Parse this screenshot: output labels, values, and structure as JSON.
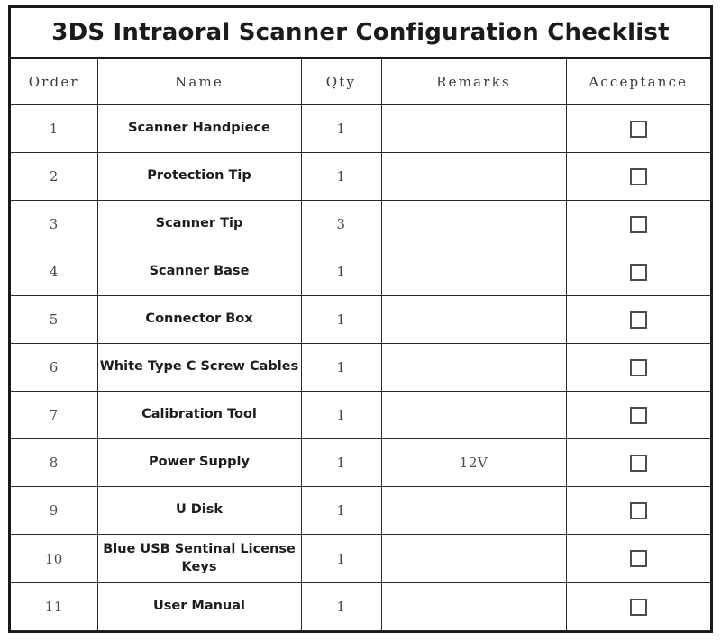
{
  "document": {
    "title": "3DS Intraoral Scanner Configuration Checklist"
  },
  "table": {
    "columns": [
      {
        "key": "order",
        "label": "Order"
      },
      {
        "key": "name",
        "label": "Name"
      },
      {
        "key": "qty",
        "label": "Qty"
      },
      {
        "key": "remarks",
        "label": "Remarks"
      },
      {
        "key": "acceptance",
        "label": "Acceptance"
      }
    ],
    "rows": [
      {
        "order": "1",
        "name": "Scanner Handpiece",
        "qty": "1",
        "remarks": "",
        "acceptance_checked": false
      },
      {
        "order": "2",
        "name": "Protection Tip",
        "qty": "1",
        "remarks": "",
        "acceptance_checked": false
      },
      {
        "order": "3",
        "name": "Scanner Tip",
        "qty": "3",
        "remarks": "",
        "acceptance_checked": false
      },
      {
        "order": "4",
        "name": "Scanner Base",
        "qty": "1",
        "remarks": "",
        "acceptance_checked": false
      },
      {
        "order": "5",
        "name": "Connector Box",
        "qty": "1",
        "remarks": "",
        "acceptance_checked": false
      },
      {
        "order": "6",
        "name": "White Type C Screw Cables",
        "qty": "1",
        "remarks": "",
        "acceptance_checked": false
      },
      {
        "order": "7",
        "name": "Calibration Tool",
        "qty": "1",
        "remarks": "",
        "acceptance_checked": false
      },
      {
        "order": "8",
        "name": "Power Supply",
        "qty": "1",
        "remarks": "12V",
        "acceptance_checked": false
      },
      {
        "order": "9",
        "name": "U Disk",
        "qty": "1",
        "remarks": "",
        "acceptance_checked": false
      },
      {
        "order": "10",
        "name": "Blue USB Sentinal License Keys",
        "qty": "1",
        "remarks": "",
        "acceptance_checked": false
      },
      {
        "order": "11",
        "name": "User Manual",
        "qty": "1",
        "remarks": "",
        "acceptance_checked": false
      }
    ]
  },
  "colors": {
    "border": "#1a1a1a",
    "grid": "#2a2a2a",
    "title_text": "#1b1b1b",
    "name_text": "#1d1d1d",
    "serif_text": "#4a4a4a",
    "checkbox_border": "#4c4c4c",
    "background": "#ffffff"
  }
}
